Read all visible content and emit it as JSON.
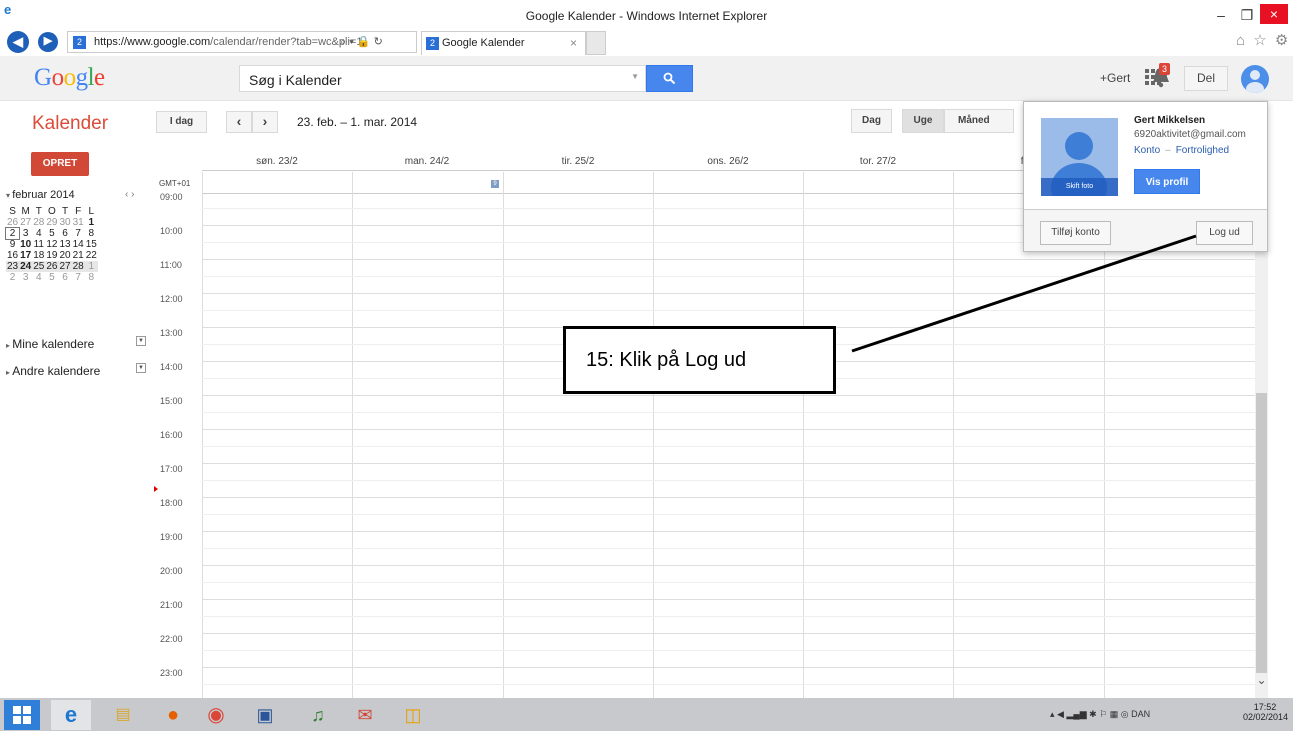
{
  "browser": {
    "window_title": "Google Kalender - Windows Internet Explorer",
    "url_host": "https://www.google.com",
    "url_path": "/calendar/render?tab=wc&pli=1",
    "address_tools": "⌕ ▾ 🔒 ↻",
    "tab_title": "Google Kalender",
    "tab_close": "×",
    "favicon": "2",
    "minimize": "–",
    "restore": "❐",
    "close": "×",
    "toolbar_icons": "⌂ ☆ ⚙"
  },
  "gbar": {
    "logo": "Google",
    "search_placeholder": "Søg i Kalender",
    "search_btn_icon": "search-icon",
    "plus_user": "+Gert",
    "notif_count": "3",
    "share": "Del"
  },
  "header": {
    "app_title": "Kalender",
    "today": "I dag",
    "prev": "‹",
    "next": "›",
    "date_range": "23. feb. – 1. mar. 2014",
    "views": [
      "Dag",
      "Uge",
      "Måned"
    ]
  },
  "sidebar": {
    "create": "OPRET",
    "month_title": "februar 2014",
    "month_nav": "‹  ›",
    "weekday_heads": [
      "S",
      "M",
      "T",
      "O",
      "T",
      "F",
      "L"
    ],
    "weeks": [
      [
        "26",
        "27",
        "28",
        "29",
        "30",
        "31",
        "1"
      ],
      [
        "2",
        "3",
        "4",
        "5",
        "6",
        "7",
        "8"
      ],
      [
        "9",
        "10",
        "11",
        "12",
        "13",
        "14",
        "15"
      ],
      [
        "16",
        "17",
        "18",
        "19",
        "20",
        "21",
        "22"
      ],
      [
        "23",
        "24",
        "25",
        "26",
        "27",
        "28",
        "1"
      ],
      [
        "2",
        "3",
        "4",
        "5",
        "6",
        "7",
        "8"
      ]
    ],
    "my_calendars": "Mine kalendere",
    "other_calendars": "Andre kalendere"
  },
  "grid": {
    "timezone": "GMT+01",
    "days": [
      "søn. 23/2",
      "man. 24/2",
      "tir. 25/2",
      "ons. 26/2",
      "tor. 27/2",
      "fre."
    ],
    "hours": [
      "09:00",
      "10:00",
      "11:00",
      "12:00",
      "13:00",
      "14:00",
      "15:00",
      "16:00",
      "17:00",
      "18:00",
      "19:00",
      "20:00",
      "21:00",
      "22:00",
      "23:00"
    ],
    "allday_marker": "9"
  },
  "account_popup": {
    "name": "Gert Mikkelsen",
    "email": "6920aktivitet@gmail.com",
    "account_link": "Konto",
    "link_sep": "–",
    "privacy_link": "Fortrolighed",
    "change_photo": "Skift foto",
    "view_profile": "Vis profil",
    "add_account": "Tilføj konto",
    "sign_out": "Log ud"
  },
  "annotation": {
    "text": "15: Klik på Log ud"
  },
  "taskbar": {
    "tray": "▴  ◀  ▂▄▆  ✱  ⚐  ▦  ◎  DAN",
    "time": "17:52",
    "date": "02/02/2014"
  }
}
